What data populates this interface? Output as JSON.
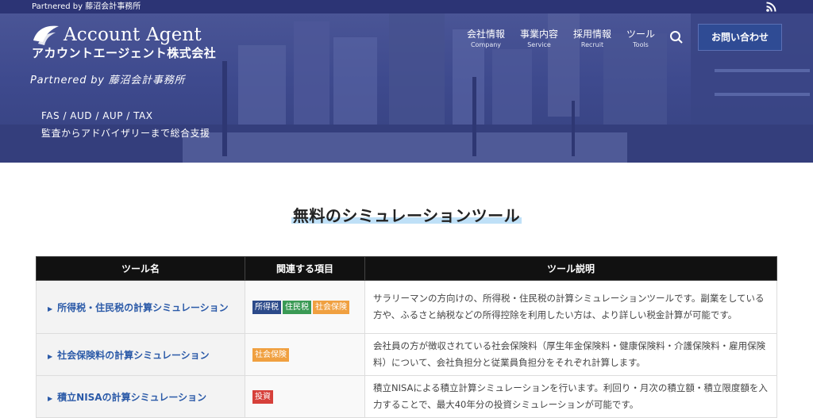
{
  "topbar": {
    "text": "Partnered by 藤沼会計事務所"
  },
  "logo": {
    "en": "Account Agent",
    "ja": "アカウントエージェント株式会社"
  },
  "partner": "Partnered by 藤沼会計事務所",
  "hero": {
    "line1": "FAS / AUD / AUP / TAX",
    "line2": "監査からアドバイザリーまで総合支援"
  },
  "nav": [
    {
      "ja": "会社情報",
      "en": "Company"
    },
    {
      "ja": "事業内容",
      "en": "Service"
    },
    {
      "ja": "採用情報",
      "en": "Recruit"
    },
    {
      "ja": "ツール",
      "en": "Tools"
    }
  ],
  "contact_label": "お問い合わせ",
  "section_title": "無料のシミュレーションツール",
  "table": {
    "headers": [
      "ツール名",
      "関連する項目",
      "ツール説明"
    ],
    "rows": [
      {
        "name": "所得税・住民税の計算シミュレーション",
        "tags": [
          {
            "label": "所得税",
            "color": "#2c4a8a"
          },
          {
            "label": "住民税",
            "color": "#3a9a55"
          },
          {
            "label": "社会保険",
            "color": "#f0a040"
          }
        ],
        "desc": "サラリーマンの方向けの、所得税・住民税の計算シミュレーションツールです。副業をしている方や、ふるさと納税などの所得控除を利用したい方は、より詳しい税金計算が可能です。"
      },
      {
        "name": "社会保険料の計算シミュレーション",
        "tags": [
          {
            "label": "社会保険",
            "color": "#f0a040"
          }
        ],
        "desc": "会社員の方が徴収されている社会保険料（厚生年金保険料・健康保険料・介護保険料・雇用保険料）について、会社負担分と従業員負担分をそれぞれ計算します。"
      },
      {
        "name": "積立NISAの計算シミュレーション",
        "tags": [
          {
            "label": "投資",
            "color": "#d6403a"
          }
        ],
        "desc": "積立NISAによる積立計算シミュレーションを行います。利回り・月次の積立額・積立限度額を入力することで、最大40年分の投資シミュレーションが可能です。"
      }
    ]
  }
}
